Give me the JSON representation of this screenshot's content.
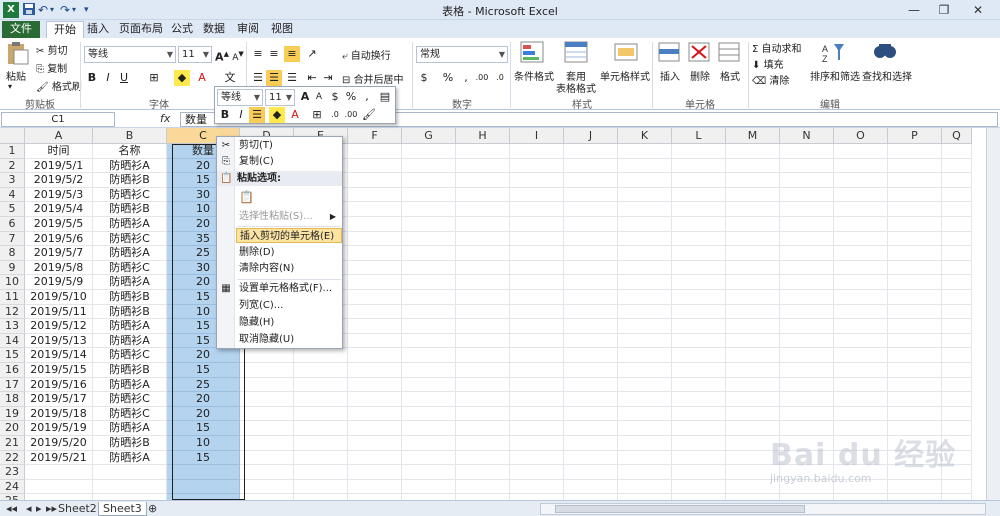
{
  "window": {
    "title": "表格 - Microsoft Excel",
    "qa_icons": [
      "save-icon",
      "undo-icon",
      "redo-icon",
      "customize-icon"
    ]
  },
  "tabs": [
    "文件",
    "开始",
    "插入",
    "页面布局",
    "公式",
    "数据",
    "审阅",
    "视图"
  ],
  "ribbon": {
    "clipboard": {
      "label": "剪贴板",
      "paste": "粘贴",
      "cut": "剪切",
      "copy": "复制",
      "format_painter": "格式刷"
    },
    "font": {
      "label": "字体",
      "name": "等线",
      "size": "11"
    },
    "alignment": {
      "wrap": "自动换行",
      "merge": "合并后居中"
    },
    "number": {
      "label": "数字",
      "format": "常规"
    },
    "styles": {
      "label": "样式",
      "cond": "条件格式",
      "table1": "套用",
      "table2": "表格格式",
      "cell_style": "单元格样式"
    },
    "cells": {
      "label": "单元格",
      "insert": "插入",
      "delete": "删除",
      "format": "格式"
    },
    "editing": {
      "label": "编辑",
      "autosum": "自动求和",
      "fill": "填充",
      "clear": "清除",
      "sort": "排序和筛选",
      "find": "查找和选择"
    }
  },
  "formula_bar": {
    "namebox": "C1",
    "fx": "fx",
    "value": "数量"
  },
  "columns": [
    "A",
    "B",
    "C",
    "D",
    "E",
    "F",
    "G",
    "H",
    "I",
    "J",
    "K",
    "L",
    "M",
    "N",
    "O",
    "P",
    "Q"
  ],
  "rows": [
    [
      "时间",
      "名称",
      "数量"
    ],
    [
      "2019/5/1",
      "防晒衫A",
      "20"
    ],
    [
      "2019/5/2",
      "防晒衫B",
      "15"
    ],
    [
      "2019/5/3",
      "防晒衫C",
      "30"
    ],
    [
      "2019/5/4",
      "防晒衫B",
      "10"
    ],
    [
      "2019/5/5",
      "防晒衫A",
      "20"
    ],
    [
      "2019/5/6",
      "防晒衫C",
      "35"
    ],
    [
      "2019/5/7",
      "防晒衫A",
      "25"
    ],
    [
      "2019/5/8",
      "防晒衫C",
      "30"
    ],
    [
      "2019/5/9",
      "防晒衫A",
      "20"
    ],
    [
      "2019/5/10",
      "防晒衫B",
      "15"
    ],
    [
      "2019/5/11",
      "防晒衫B",
      "10"
    ],
    [
      "2019/5/12",
      "防晒衫A",
      "15"
    ],
    [
      "2019/5/13",
      "防晒衫A",
      "15"
    ],
    [
      "2019/5/14",
      "防晒衫C",
      "20"
    ],
    [
      "2019/5/15",
      "防晒衫B",
      "15"
    ],
    [
      "2019/5/16",
      "防晒衫A",
      "25"
    ],
    [
      "2019/5/17",
      "防晒衫C",
      "20"
    ],
    [
      "2019/5/18",
      "防晒衫C",
      "20"
    ],
    [
      "2019/5/19",
      "防晒衫A",
      "15"
    ],
    [
      "2019/5/20",
      "防晒衫B",
      "10"
    ],
    [
      "2019/5/21",
      "防晒衫A",
      "15"
    ],
    [
      "",
      "",
      ""
    ],
    [
      "",
      "",
      ""
    ],
    [
      "",
      "",
      ""
    ]
  ],
  "mini_toolbar": {
    "font": "等线",
    "size": "11"
  },
  "context_menu": {
    "cut": "剪切(T)",
    "copy": "复制(C)",
    "paste_options": "粘贴选项:",
    "paste_special": "选择性粘贴(S)...",
    "insert_cut": "插入剪切的单元格(E)",
    "delete": "删除(D)",
    "clear": "清除内容(N)",
    "format_cells": "设置单元格格式(F)...",
    "col_width": "列宽(C)...",
    "hide": "隐藏(H)",
    "unhide": "取消隐藏(U)"
  },
  "sheets": [
    "Sheet2",
    "Sheet3"
  ],
  "watermark": {
    "text": "Bai du 经验",
    "url": "jingyan.baidu.com"
  },
  "colors": {
    "selection": "#b3d3ef",
    "accent": "#2a6a35",
    "highlight": "#fbe3a4"
  }
}
